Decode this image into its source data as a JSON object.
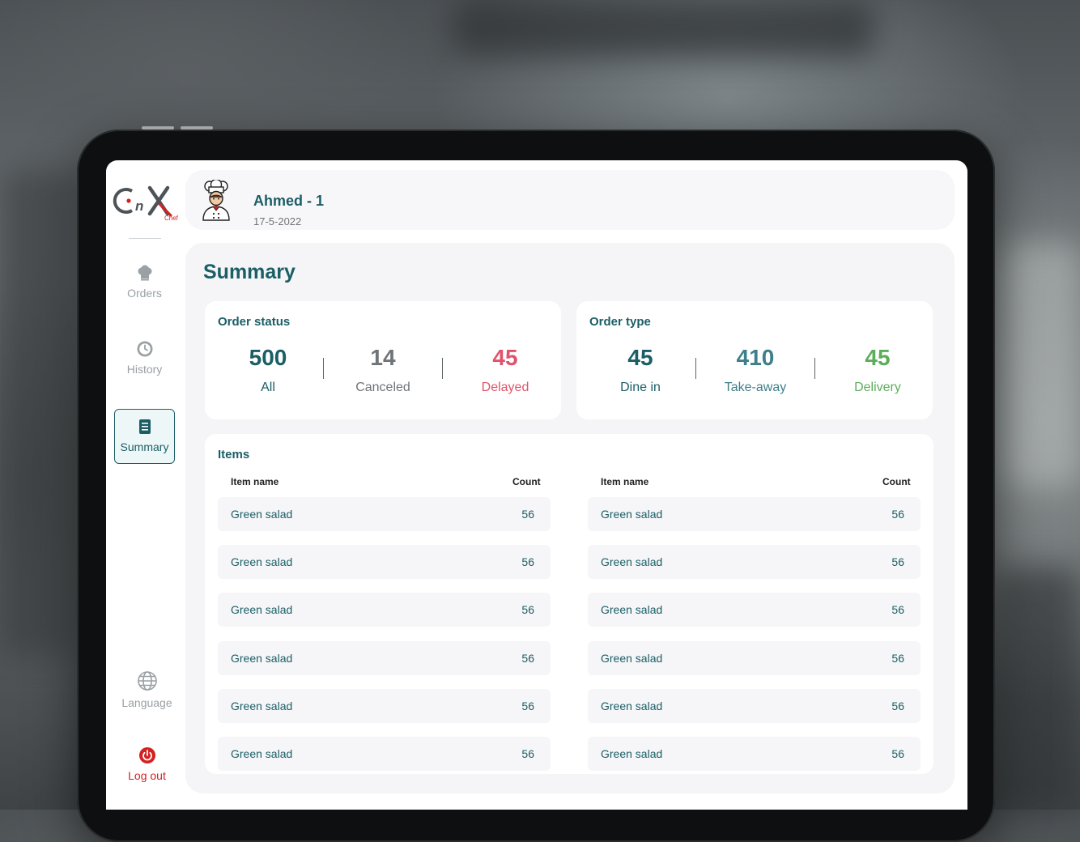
{
  "brand": {
    "logo_text": "OnX",
    "logo_sub": "Chef"
  },
  "user": {
    "name": "Ahmed - 1",
    "date": "17-5-2022"
  },
  "sidebar": {
    "items": [
      {
        "label": "Orders",
        "icon": "chef-hat-icon"
      },
      {
        "label": "History",
        "icon": "clock-icon"
      },
      {
        "label": "Summary",
        "icon": "receipt-icon",
        "active": true
      },
      {
        "label": "Language",
        "icon": "globe-icon"
      },
      {
        "label": "Log out",
        "icon": "power-icon"
      }
    ]
  },
  "page": {
    "title": "Summary"
  },
  "order_status": {
    "title": "Order status",
    "stats": [
      {
        "value": "500",
        "label": "All",
        "color": "#1b5e66"
      },
      {
        "value": "14",
        "label": "Canceled",
        "color": "#707478"
      },
      {
        "value": "45",
        "label": "Delayed",
        "color": "#e0546c"
      }
    ]
  },
  "order_type": {
    "title": "Order type",
    "stats": [
      {
        "value": "45",
        "label": "Dine in",
        "color": "#1b5e66"
      },
      {
        "value": "410",
        "label": "Take-away",
        "color": "#3f7f8a"
      },
      {
        "value": "45",
        "label": "Delivery",
        "color": "#5cae5c"
      }
    ]
  },
  "items": {
    "title": "Items",
    "columns": {
      "name": "Item name",
      "count": "Count"
    },
    "left": [
      {
        "name": "Green salad",
        "count": "56"
      },
      {
        "name": "Green salad",
        "count": "56"
      },
      {
        "name": "Green salad",
        "count": "56"
      },
      {
        "name": "Green salad",
        "count": "56"
      },
      {
        "name": "Green salad",
        "count": "56"
      },
      {
        "name": "Green salad",
        "count": "56"
      }
    ],
    "right": [
      {
        "name": "Green salad",
        "count": "56"
      },
      {
        "name": "Green salad",
        "count": "56"
      },
      {
        "name": "Green salad",
        "count": "56"
      },
      {
        "name": "Green salad",
        "count": "56"
      },
      {
        "name": "Green salad",
        "count": "56"
      },
      {
        "name": "Green salad",
        "count": "56"
      }
    ]
  },
  "colors": {
    "accent": "#1b5e66",
    "danger": "#d32121",
    "delayed": "#e0546c",
    "delivery": "#5cae5c"
  }
}
